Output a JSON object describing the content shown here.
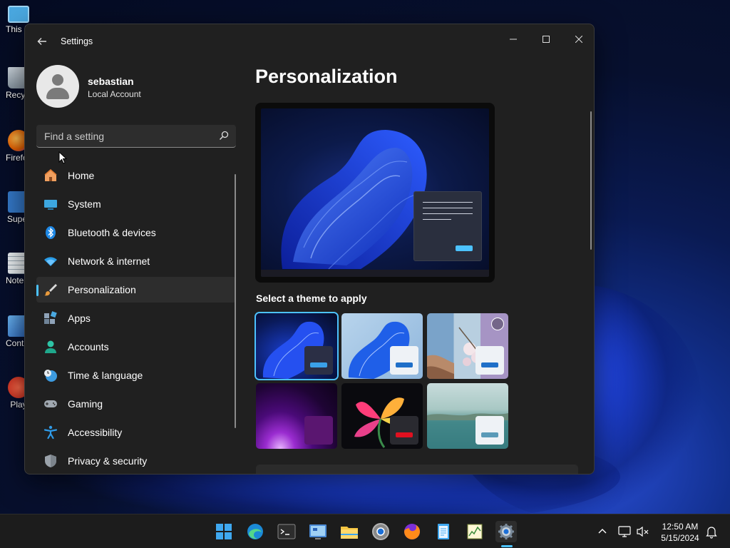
{
  "desktop": {
    "icons": [
      {
        "label": "This PC",
        "color": "#4aa8e0"
      },
      {
        "label": "Recycle Bin",
        "color": "#9aa6b0"
      },
      {
        "label": "Firefox",
        "color": "#e66000"
      },
      {
        "label": "Super",
        "color": "#3478c8"
      },
      {
        "label": "Notepad",
        "color": "#dfe6ea"
      },
      {
        "label": "Control Panel",
        "color": "#4a8ad6"
      },
      {
        "label": "Play",
        "color": "#d83b2a"
      }
    ]
  },
  "window": {
    "title": "Settings",
    "controls": {
      "minimize": "—",
      "maximize": "☐",
      "close": "✕"
    }
  },
  "profile": {
    "name": "sebastian",
    "account_type": "Local Account"
  },
  "search": {
    "placeholder": "Find a setting"
  },
  "nav": {
    "items": [
      {
        "label": "Home",
        "icon": "home-icon"
      },
      {
        "label": "System",
        "icon": "system-icon"
      },
      {
        "label": "Bluetooth & devices",
        "icon": "bluetooth-icon"
      },
      {
        "label": "Network & internet",
        "icon": "wifi-icon"
      },
      {
        "label": "Personalization",
        "icon": "brush-icon",
        "active": true
      },
      {
        "label": "Apps",
        "icon": "apps-icon"
      },
      {
        "label": "Accounts",
        "icon": "accounts-icon"
      },
      {
        "label": "Time & language",
        "icon": "clock-globe-icon"
      },
      {
        "label": "Gaming",
        "icon": "gamepad-icon"
      },
      {
        "label": "Accessibility",
        "icon": "accessibility-icon"
      },
      {
        "label": "Privacy & security",
        "icon": "shield-icon"
      }
    ]
  },
  "main": {
    "title": "Personalization",
    "themes_label": "Select a theme to apply",
    "themes": [
      {
        "name": "windows-dark",
        "selected": true
      },
      {
        "name": "windows-light",
        "selected": false
      },
      {
        "name": "windows-spotlight",
        "selected": false
      },
      {
        "name": "glow",
        "selected": false
      },
      {
        "name": "captured-motion",
        "selected": false
      },
      {
        "name": "flow",
        "selected": false
      }
    ]
  },
  "taskbar": {
    "apps": [
      "start-icon",
      "edge-icon",
      "terminal-icon",
      "control-panel-icon",
      "file-explorer-icon",
      "chrome-icon",
      "firefox-icon",
      "notepad-icon",
      "task-manager-icon",
      "settings-icon"
    ],
    "active_app": "settings-icon",
    "tray_chevron": "^",
    "time": "12:50 AM",
    "date": "5/15/2024"
  },
  "colors": {
    "accent": "#4cc2ff",
    "window_bg": "#202020",
    "nav_active_bg": "#2d2d2d"
  }
}
